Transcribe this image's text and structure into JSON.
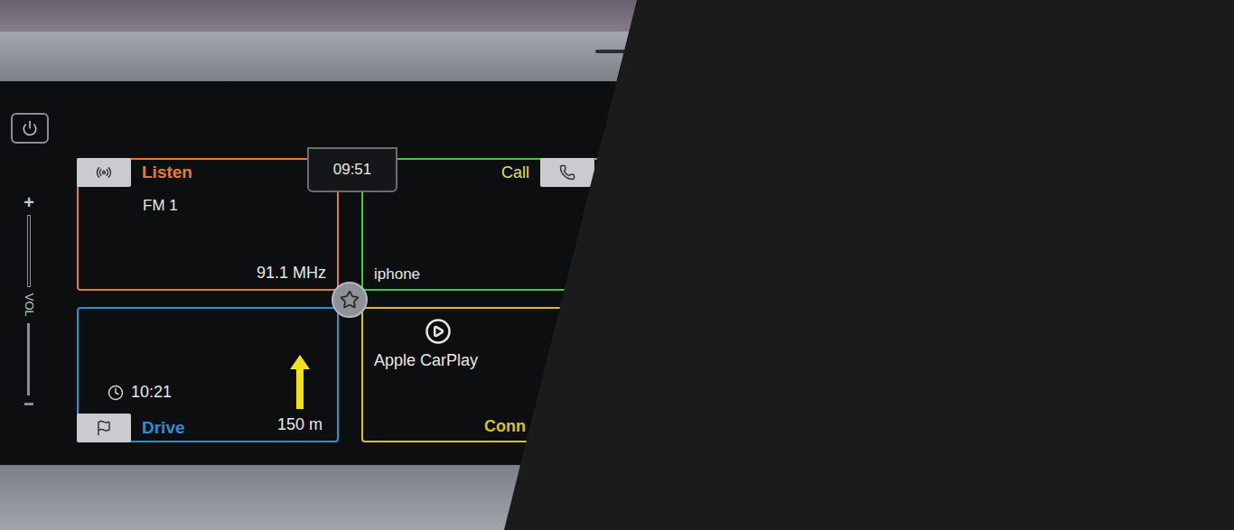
{
  "clock": "09:51",
  "volume": {
    "label": "VOL",
    "plus": "+"
  },
  "tiles": [
    {
      "kind": "listen",
      "title": "Listen",
      "source": "FM 1",
      "value": "91.1 MHz",
      "color": "#e07b3c"
    },
    {
      "kind": "call",
      "title": "Call",
      "value": "iphone",
      "color": "#4cc24c"
    },
    {
      "kind": "drive",
      "title": "Drive",
      "eta": "10:21",
      "distance": "150 m",
      "color": "#2a8fd6"
    },
    {
      "kind": "connect",
      "title": "Conn",
      "app": "Apple CarPlay",
      "color": "#d8c030"
    }
  ]
}
